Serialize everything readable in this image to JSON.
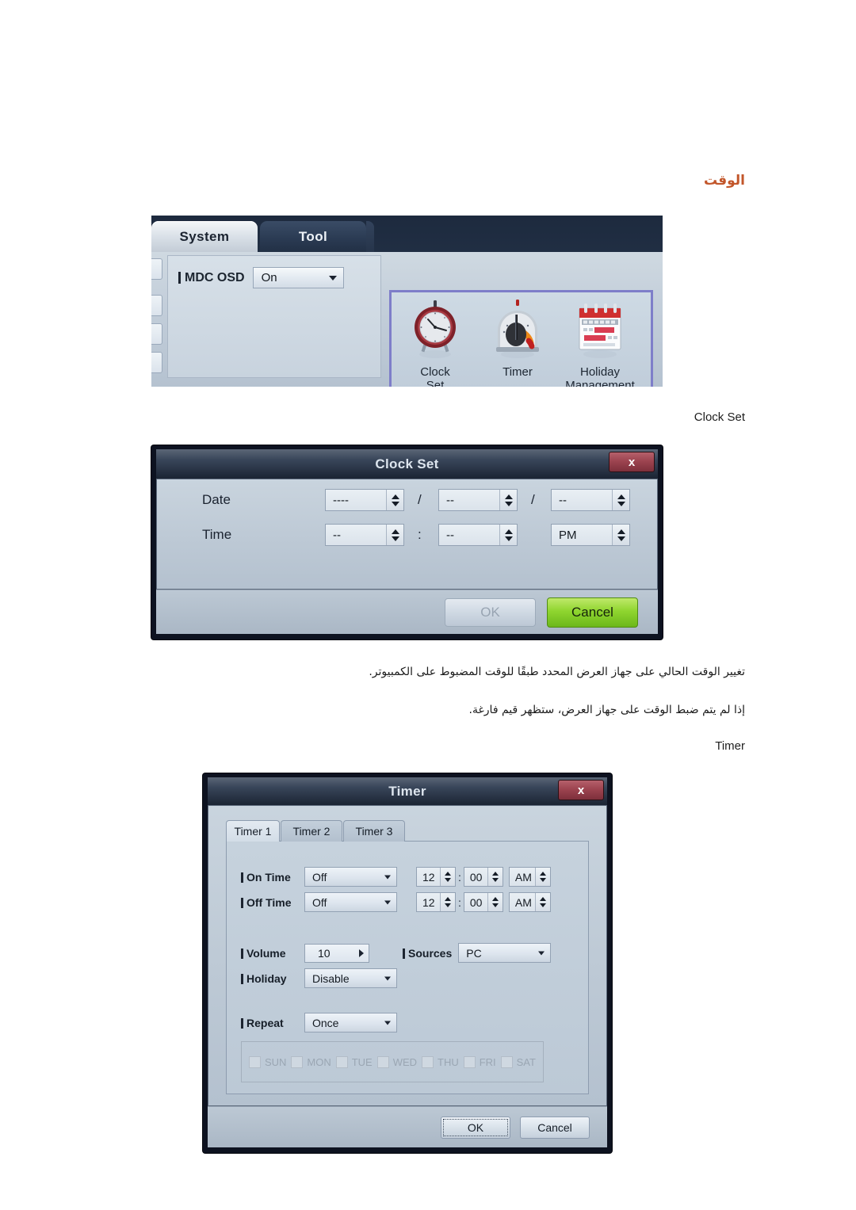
{
  "page": {
    "heading_ar": "الوقت",
    "heading_color": "#c2562a",
    "paragraph_1_ar": "تغيير الوقت الحالي على جهاز العرض المحدد طبقًا للوقت المضبوط على الكمبيوتر.",
    "paragraph_2_ar": "إذا لم يتم ضبط الوقت على جهاز العرض، ستظهر قيم فارغة.",
    "caption_clock_set": "Clock Set",
    "caption_timer": "Timer"
  },
  "mdc_panel": {
    "tabs": [
      {
        "label": "System",
        "active": true
      },
      {
        "label": "Tool",
        "active": false
      }
    ],
    "settings": {
      "mdc_osd_label": "MDC OSD",
      "mdc_osd_value": "On"
    },
    "selection_border_color": "#7e7ec9",
    "icons": [
      {
        "name": "clock-set-icon",
        "caption_line1": "Clock",
        "caption_line2": "Set"
      },
      {
        "name": "timer-icon",
        "caption_line1": "Timer",
        "caption_line2": ""
      },
      {
        "name": "holiday-management-icon",
        "caption_line1": "Holiday",
        "caption_line2": "Management"
      }
    ]
  },
  "clock_set_dialog": {
    "title": "Clock Set",
    "close_label": "x",
    "date_label": "Date",
    "time_label": "Time",
    "date_year": "----",
    "date_month": "--",
    "date_day": "--",
    "date_sep_1": "/",
    "date_sep_2": "/",
    "time_hour": "--",
    "time_minute": "--",
    "time_meridiem": "PM",
    "time_sep": ":",
    "ok_label": "OK",
    "ok_enabled": false,
    "cancel_label": "Cancel",
    "cancel_color": "#8fd52f"
  },
  "timer_dialog": {
    "title": "Timer",
    "close_label": "x",
    "tabs": [
      {
        "label": "Timer 1",
        "active": true
      },
      {
        "label": "Timer 2",
        "active": false
      },
      {
        "label": "Timer 3",
        "active": false
      }
    ],
    "on_time": {
      "label": "On Time",
      "state": "Off",
      "hour": "12",
      "minute": "00",
      "meridiem": "AM",
      "separator": ":"
    },
    "off_time": {
      "label": "Off Time",
      "state": "Off",
      "hour": "12",
      "minute": "00",
      "meridiem": "AM",
      "separator": ":"
    },
    "volume": {
      "label": "Volume",
      "value": "10"
    },
    "sources": {
      "label": "Sources",
      "value": "PC"
    },
    "holiday": {
      "label": "Holiday",
      "value": "Disable"
    },
    "repeat": {
      "label": "Repeat",
      "value": "Once"
    },
    "days": [
      {
        "label": "SUN",
        "checked": false
      },
      {
        "label": "MON",
        "checked": false
      },
      {
        "label": "TUE",
        "checked": false
      },
      {
        "label": "WED",
        "checked": false
      },
      {
        "label": "THU",
        "checked": false
      },
      {
        "label": "FRI",
        "checked": false
      },
      {
        "label": "SAT",
        "checked": false
      }
    ],
    "ok_label": "OK",
    "cancel_label": "Cancel"
  }
}
